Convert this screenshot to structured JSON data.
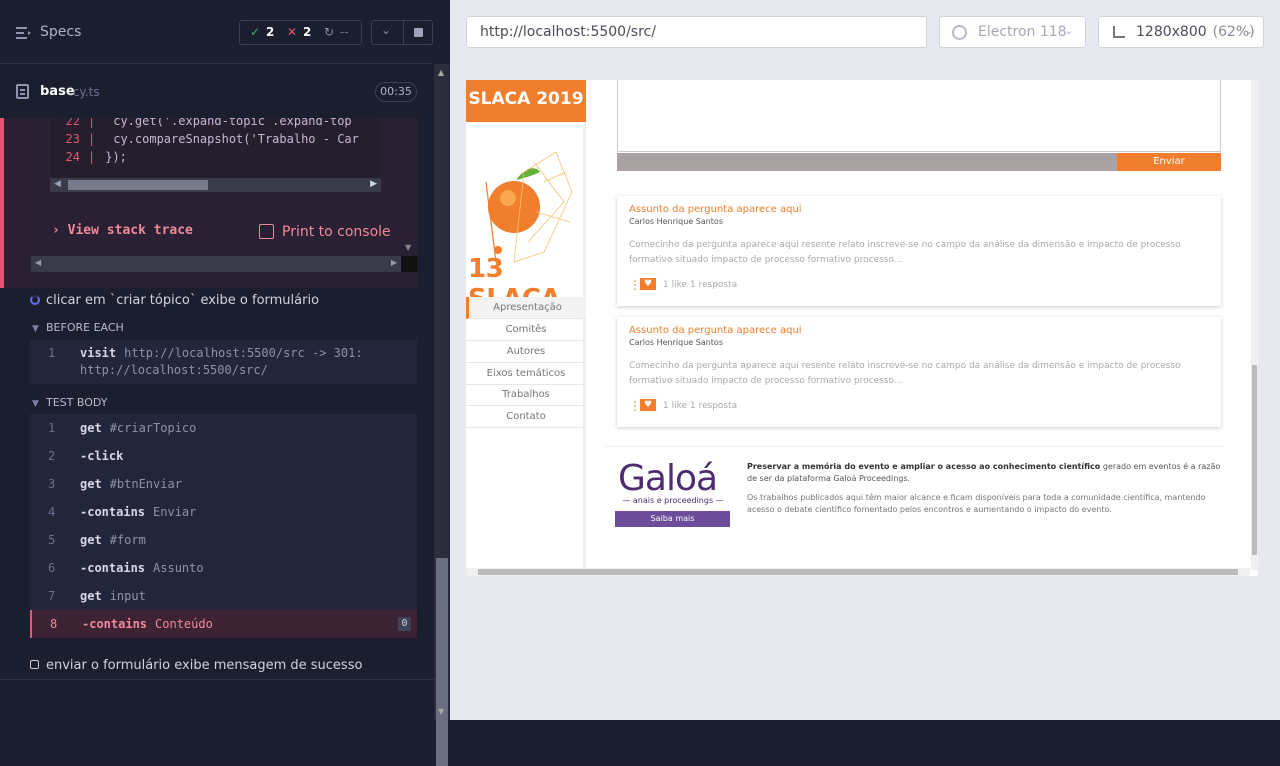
{
  "reporter": {
    "title": "Specs",
    "passed": "2",
    "failed": "2",
    "pending": "--",
    "file_name": "base",
    "file_ext": ".cy.ts",
    "duration": "00:35",
    "code_lines": [
      {
        "num": "22",
        "code": "cy.get('.expand-topic .expand-top"
      },
      {
        "num": "23",
        "code": "cy.compareSnapshot('Trabalho - Car"
      },
      {
        "num": "24",
        "code": "});"
      }
    ],
    "view_stack_trace": "View stack trace",
    "print_to_console": "Print to console",
    "test1_title": "clicar em `criar tópico` exibe o formulário",
    "before_each_label": "BEFORE EACH",
    "before_each": [
      {
        "num": "1",
        "name": "visit",
        "arg": "http://localhost:5500/src -> 301:",
        "arg2": "http://localhost:5500/src/"
      }
    ],
    "test_body_label": "TEST BODY",
    "commands": [
      {
        "num": "1",
        "name": "get",
        "arg": "#criarTopico"
      },
      {
        "num": "2",
        "name": "-click",
        "arg": ""
      },
      {
        "num": "3",
        "name": "get",
        "arg": "#btnEnviar"
      },
      {
        "num": "4",
        "name": "-contains",
        "arg": "Enviar"
      },
      {
        "num": "5",
        "name": "get",
        "arg": "#form"
      },
      {
        "num": "6",
        "name": "-contains",
        "arg": "Assunto"
      },
      {
        "num": "7",
        "name": "get",
        "arg": "input"
      },
      {
        "num": "8",
        "name": "-contains",
        "arg": "Conteúdo",
        "badge": "0"
      }
    ],
    "test2_title": "enviar o formulário exibe mensagem de sucesso"
  },
  "toolbar": {
    "url": "http://localhost:5500/src/",
    "browser": "Electron 118",
    "viewport": "1280x800",
    "scale": "(62%)"
  },
  "app": {
    "sidebar_title": "SLACA 2019",
    "sidebar_logo_text": "13 SLACA",
    "nav": [
      "Apresentação",
      "Comitês",
      "Autores",
      "Eixos temáticos",
      "Trabalhos",
      "Contato"
    ],
    "send_button": "Enviar",
    "cards": [
      {
        "title": "Assunto da pergunta aparece aqui",
        "author": "Carlos Henrique Santos",
        "desc": "Comecinho da pergunta aparece aqui resente relato inscreve-se no campo da análise da dimensão e impacto de processo formativo situado impacto de processo formativo processo...",
        "stats": "1 like  1 resposta"
      },
      {
        "title": "Assunto da pergunta aparece aqui",
        "author": "Carlos Henrique Santos",
        "desc": "Comecinho da pergunta aparece aqui resente relato inscreve-se no campo da análise da dimensão e impacto de processo formativo situado impacto de processo formativo processo...",
        "stats": "1 like  1 resposta"
      }
    ],
    "galoa_logo": "Galoá",
    "galoa_sub": "— anais e proceedings —",
    "saiba_mais": "Saiba mais",
    "footer_bold": "Preservar a memória do evento e ampliar o acesso ao conhecimento científico",
    "footer_rest": " gerado em eventos é a razão de ser da plataforma Galoá Proceedings.",
    "footer_2": "Os trabalhos publicados aqui têm maior alcance e ficam disponíveis para toda a comunidade científica, mantendo acesso o debate científico fomentado pelos encontros e aumentando o impacto do evento."
  }
}
